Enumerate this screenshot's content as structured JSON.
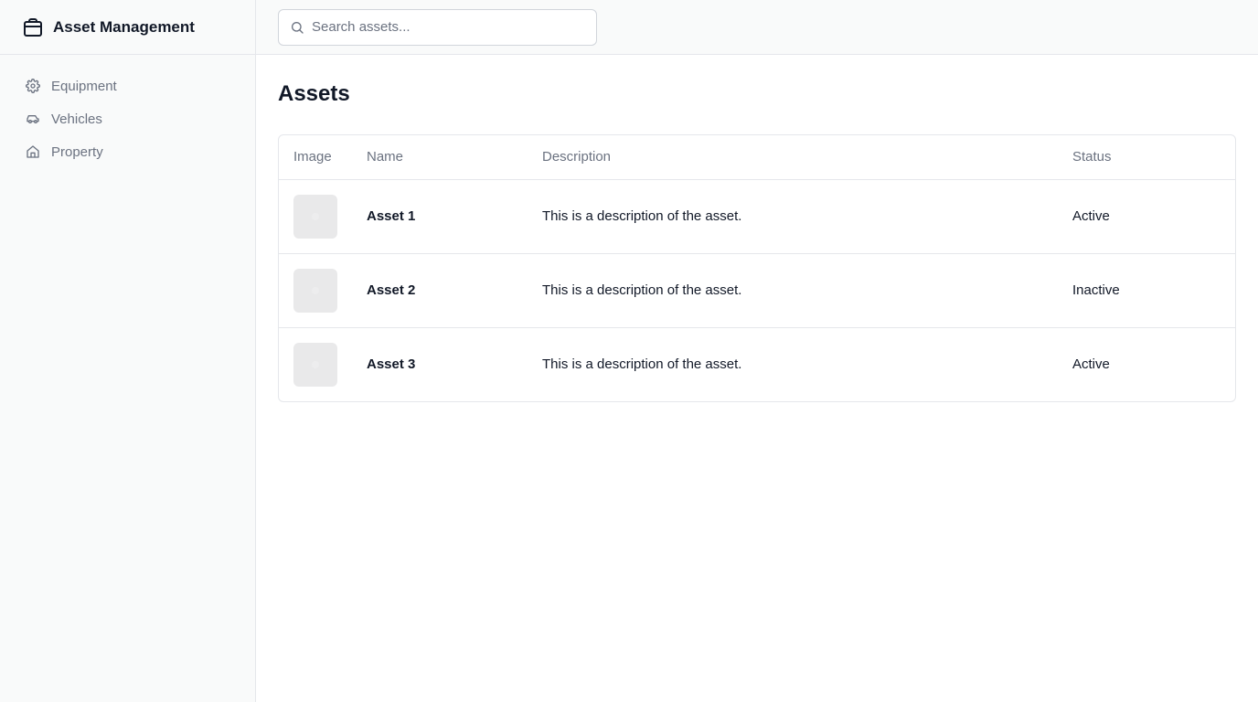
{
  "app": {
    "title": "Asset Management",
    "icon": "briefcase-icon"
  },
  "sidebar": {
    "items": [
      {
        "label": "Equipment",
        "icon": "gear-icon"
      },
      {
        "label": "Vehicles",
        "icon": "car-icon"
      },
      {
        "label": "Property",
        "icon": "home-icon"
      }
    ]
  },
  "search": {
    "placeholder": "Search assets...",
    "value": "",
    "icon": "search-icon"
  },
  "main": {
    "title": "Assets"
  },
  "table": {
    "columns": [
      "Image",
      "Name",
      "Description",
      "Status"
    ],
    "rows": [
      {
        "name": "Asset 1",
        "description": "This is a description of the asset.",
        "status": "Active"
      },
      {
        "name": "Asset 2",
        "description": "This is a description of the asset.",
        "status": "Inactive"
      },
      {
        "name": "Asset 3",
        "description": "This is a description of the asset.",
        "status": "Active"
      }
    ]
  },
  "colors": {
    "sidebar_bg": "#f9fafa",
    "border": "#e5e7eb",
    "muted_text": "#6b7280",
    "text": "#111827",
    "thumb_bg": "#e9e9ea"
  }
}
